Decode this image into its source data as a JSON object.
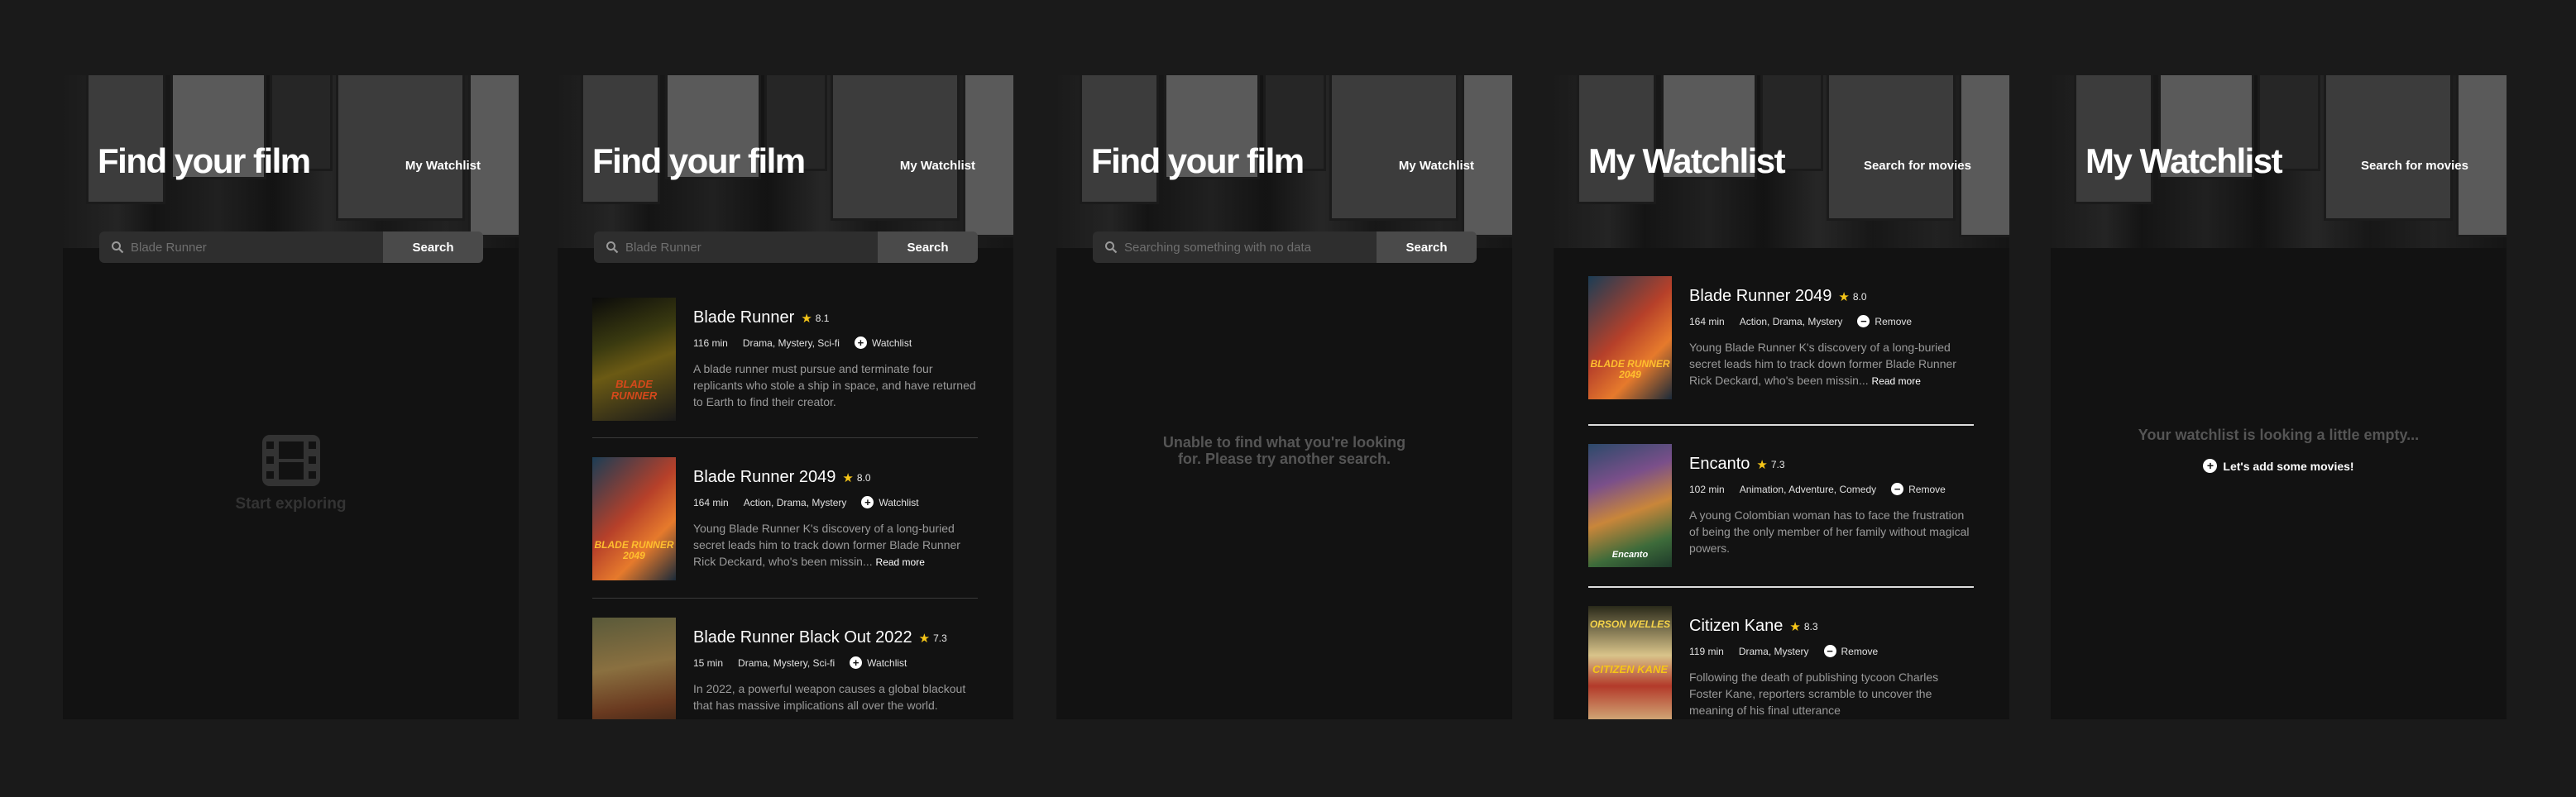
{
  "screens": [
    {
      "title": "Find your film",
      "nav_link": "My Watchlist",
      "search": {
        "value": "Blade Runner",
        "button": "Search"
      },
      "placeholder_state": {
        "icon": "film-icon",
        "label": "Start exploring"
      }
    },
    {
      "title": "Find your film",
      "nav_link": "My Watchlist",
      "search": {
        "value": "Blade Runner",
        "button": "Search"
      },
      "movies": [
        {
          "title": "Blade Runner",
          "rating": "8.1",
          "runtime": "116 min",
          "genres": "Drama, Mystery, Sci-fi",
          "action": "Watchlist",
          "description": "A blade runner must pursue and terminate four replicants who stole a ship in space, and have returned to Earth to find their creator.",
          "read_more": ""
        },
        {
          "title": "Blade Runner 2049",
          "rating": "8.0",
          "runtime": "164 min",
          "genres": "Action, Drama, Mystery",
          "action": "Watchlist",
          "description": "Young Blade Runner K's discovery of a long-buried secret leads him to track down former Blade Runner Rick Deckard, who's been missin...",
          "read_more": "Read more"
        },
        {
          "title": "Blade Runner Black Out 2022",
          "rating": "7.3",
          "runtime": "15 min",
          "genres": "Drama, Mystery, Sci-fi",
          "action": "Watchlist",
          "description": "In 2022, a powerful weapon causes a global blackout that has massive implications all over the world.",
          "read_more": ""
        }
      ]
    },
    {
      "title": "Find your film",
      "nav_link": "My Watchlist",
      "search": {
        "value": "Searching something with no data",
        "button": "Search"
      },
      "error_message": "Unable to find what you're looking for. Please try another search."
    },
    {
      "title": "My Watchlist",
      "nav_link": "Search for movies",
      "movies": [
        {
          "title": "Blade Runner 2049",
          "rating": "8.0",
          "runtime": "164 min",
          "genres": "Action, Drama, Mystery",
          "action": "Remove",
          "description": "Young Blade Runner K's discovery of a long-buried secret leads him to track down former Blade Runner Rick Deckard, who's been missin...",
          "read_more": "Read more"
        },
        {
          "title": "Encanto",
          "rating": "7.3",
          "runtime": "102 min",
          "genres": "Animation, Adventure, Comedy",
          "action": "Remove",
          "description": "A young Colombian woman has to face the frustration of being the only member of her family without magical powers.",
          "read_more": ""
        },
        {
          "title": "Citizen Kane",
          "rating": "8.3",
          "runtime": "119 min",
          "genres": "Drama, Mystery",
          "action": "Remove",
          "description": "Following the death of publishing tycoon Charles Foster Kane, reporters scramble to uncover the meaning of his final utterance",
          "read_more": ""
        }
      ]
    },
    {
      "title": "My Watchlist",
      "nav_link": "Search for movies",
      "empty_message": "Your watchlist is looking a little empty...",
      "add_link": "Let's add some movies!"
    }
  ],
  "poster_art": {
    "blade_runner": "BLADE RUNNER",
    "blade_runner_2049": "BLADE RUNNER 2049",
    "encanto": "Encanto",
    "citizen_kane_top": "ORSON WELLES",
    "citizen_kane": "CITIZEN KANE"
  },
  "colors": {
    "background": "#1a1a1a",
    "panel": "#121212",
    "accent_star": "#f5c518",
    "muted_text": "#9a9a9a"
  }
}
